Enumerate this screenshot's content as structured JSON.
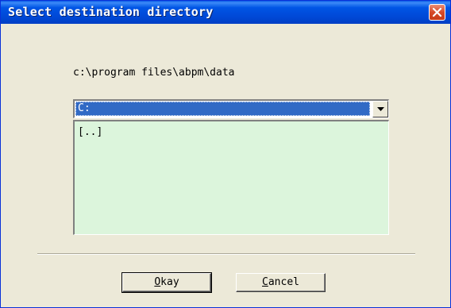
{
  "window": {
    "title": "Select destination directory",
    "close_icon": "close-icon"
  },
  "path": {
    "current": "c:\\program files\\abpm\\data"
  },
  "drive_select": {
    "value": "C:",
    "dropdown_icon": "chevron-down-icon"
  },
  "directory_list": {
    "items": [
      "[..]"
    ]
  },
  "buttons": {
    "okay": {
      "mnemonic": "O",
      "rest": "kay"
    },
    "cancel": {
      "mnemonic": "C",
      "rest": "ancel"
    }
  },
  "colors": {
    "title_bar": "#0055e5",
    "dialog_bg": "#ece9d8",
    "list_bg": "#dcf5dc",
    "selection": "#316ac5",
    "close_button": "#d64a28"
  }
}
